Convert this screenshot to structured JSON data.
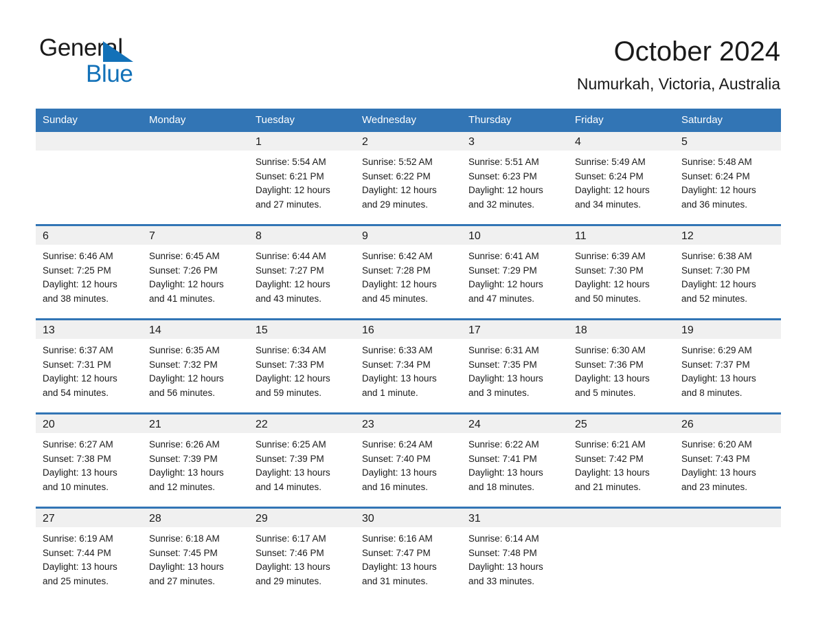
{
  "brand": {
    "name_line1": "General",
    "name_line2": "Blue",
    "accent_color": "#1271b8"
  },
  "header": {
    "month_title": "October 2024",
    "location": "Numurkah, Victoria, Australia"
  },
  "calendar": {
    "header_background": "#3275b5",
    "daynum_band_background": "#f0f0f0",
    "weekdays": [
      "Sunday",
      "Monday",
      "Tuesday",
      "Wednesday",
      "Thursday",
      "Friday",
      "Saturday"
    ],
    "weeks": [
      [
        {
          "day": "",
          "sunrise": "",
          "sunset": "",
          "daylight_line1": "",
          "daylight_line2": ""
        },
        {
          "day": "",
          "sunrise": "",
          "sunset": "",
          "daylight_line1": "",
          "daylight_line2": ""
        },
        {
          "day": "1",
          "sunrise": "Sunrise: 5:54 AM",
          "sunset": "Sunset: 6:21 PM",
          "daylight_line1": "Daylight: 12 hours",
          "daylight_line2": "and 27 minutes."
        },
        {
          "day": "2",
          "sunrise": "Sunrise: 5:52 AM",
          "sunset": "Sunset: 6:22 PM",
          "daylight_line1": "Daylight: 12 hours",
          "daylight_line2": "and 29 minutes."
        },
        {
          "day": "3",
          "sunrise": "Sunrise: 5:51 AM",
          "sunset": "Sunset: 6:23 PM",
          "daylight_line1": "Daylight: 12 hours",
          "daylight_line2": "and 32 minutes."
        },
        {
          "day": "4",
          "sunrise": "Sunrise: 5:49 AM",
          "sunset": "Sunset: 6:24 PM",
          "daylight_line1": "Daylight: 12 hours",
          "daylight_line2": "and 34 minutes."
        },
        {
          "day": "5",
          "sunrise": "Sunrise: 5:48 AM",
          "sunset": "Sunset: 6:24 PM",
          "daylight_line1": "Daylight: 12 hours",
          "daylight_line2": "and 36 minutes."
        }
      ],
      [
        {
          "day": "6",
          "sunrise": "Sunrise: 6:46 AM",
          "sunset": "Sunset: 7:25 PM",
          "daylight_line1": "Daylight: 12 hours",
          "daylight_line2": "and 38 minutes."
        },
        {
          "day": "7",
          "sunrise": "Sunrise: 6:45 AM",
          "sunset": "Sunset: 7:26 PM",
          "daylight_line1": "Daylight: 12 hours",
          "daylight_line2": "and 41 minutes."
        },
        {
          "day": "8",
          "sunrise": "Sunrise: 6:44 AM",
          "sunset": "Sunset: 7:27 PM",
          "daylight_line1": "Daylight: 12 hours",
          "daylight_line2": "and 43 minutes."
        },
        {
          "day": "9",
          "sunrise": "Sunrise: 6:42 AM",
          "sunset": "Sunset: 7:28 PM",
          "daylight_line1": "Daylight: 12 hours",
          "daylight_line2": "and 45 minutes."
        },
        {
          "day": "10",
          "sunrise": "Sunrise: 6:41 AM",
          "sunset": "Sunset: 7:29 PM",
          "daylight_line1": "Daylight: 12 hours",
          "daylight_line2": "and 47 minutes."
        },
        {
          "day": "11",
          "sunrise": "Sunrise: 6:39 AM",
          "sunset": "Sunset: 7:30 PM",
          "daylight_line1": "Daylight: 12 hours",
          "daylight_line2": "and 50 minutes."
        },
        {
          "day": "12",
          "sunrise": "Sunrise: 6:38 AM",
          "sunset": "Sunset: 7:30 PM",
          "daylight_line1": "Daylight: 12 hours",
          "daylight_line2": "and 52 minutes."
        }
      ],
      [
        {
          "day": "13",
          "sunrise": "Sunrise: 6:37 AM",
          "sunset": "Sunset: 7:31 PM",
          "daylight_line1": "Daylight: 12 hours",
          "daylight_line2": "and 54 minutes."
        },
        {
          "day": "14",
          "sunrise": "Sunrise: 6:35 AM",
          "sunset": "Sunset: 7:32 PM",
          "daylight_line1": "Daylight: 12 hours",
          "daylight_line2": "and 56 minutes."
        },
        {
          "day": "15",
          "sunrise": "Sunrise: 6:34 AM",
          "sunset": "Sunset: 7:33 PM",
          "daylight_line1": "Daylight: 12 hours",
          "daylight_line2": "and 59 minutes."
        },
        {
          "day": "16",
          "sunrise": "Sunrise: 6:33 AM",
          "sunset": "Sunset: 7:34 PM",
          "daylight_line1": "Daylight: 13 hours",
          "daylight_line2": "and 1 minute."
        },
        {
          "day": "17",
          "sunrise": "Sunrise: 6:31 AM",
          "sunset": "Sunset: 7:35 PM",
          "daylight_line1": "Daylight: 13 hours",
          "daylight_line2": "and 3 minutes."
        },
        {
          "day": "18",
          "sunrise": "Sunrise: 6:30 AM",
          "sunset": "Sunset: 7:36 PM",
          "daylight_line1": "Daylight: 13 hours",
          "daylight_line2": "and 5 minutes."
        },
        {
          "day": "19",
          "sunrise": "Sunrise: 6:29 AM",
          "sunset": "Sunset: 7:37 PM",
          "daylight_line1": "Daylight: 13 hours",
          "daylight_line2": "and 8 minutes."
        }
      ],
      [
        {
          "day": "20",
          "sunrise": "Sunrise: 6:27 AM",
          "sunset": "Sunset: 7:38 PM",
          "daylight_line1": "Daylight: 13 hours",
          "daylight_line2": "and 10 minutes."
        },
        {
          "day": "21",
          "sunrise": "Sunrise: 6:26 AM",
          "sunset": "Sunset: 7:39 PM",
          "daylight_line1": "Daylight: 13 hours",
          "daylight_line2": "and 12 minutes."
        },
        {
          "day": "22",
          "sunrise": "Sunrise: 6:25 AM",
          "sunset": "Sunset: 7:39 PM",
          "daylight_line1": "Daylight: 13 hours",
          "daylight_line2": "and 14 minutes."
        },
        {
          "day": "23",
          "sunrise": "Sunrise: 6:24 AM",
          "sunset": "Sunset: 7:40 PM",
          "daylight_line1": "Daylight: 13 hours",
          "daylight_line2": "and 16 minutes."
        },
        {
          "day": "24",
          "sunrise": "Sunrise: 6:22 AM",
          "sunset": "Sunset: 7:41 PM",
          "daylight_line1": "Daylight: 13 hours",
          "daylight_line2": "and 18 minutes."
        },
        {
          "day": "25",
          "sunrise": "Sunrise: 6:21 AM",
          "sunset": "Sunset: 7:42 PM",
          "daylight_line1": "Daylight: 13 hours",
          "daylight_line2": "and 21 minutes."
        },
        {
          "day": "26",
          "sunrise": "Sunrise: 6:20 AM",
          "sunset": "Sunset: 7:43 PM",
          "daylight_line1": "Daylight: 13 hours",
          "daylight_line2": "and 23 minutes."
        }
      ],
      [
        {
          "day": "27",
          "sunrise": "Sunrise: 6:19 AM",
          "sunset": "Sunset: 7:44 PM",
          "daylight_line1": "Daylight: 13 hours",
          "daylight_line2": "and 25 minutes."
        },
        {
          "day": "28",
          "sunrise": "Sunrise: 6:18 AM",
          "sunset": "Sunset: 7:45 PM",
          "daylight_line1": "Daylight: 13 hours",
          "daylight_line2": "and 27 minutes."
        },
        {
          "day": "29",
          "sunrise": "Sunrise: 6:17 AM",
          "sunset": "Sunset: 7:46 PM",
          "daylight_line1": "Daylight: 13 hours",
          "daylight_line2": "and 29 minutes."
        },
        {
          "day": "30",
          "sunrise": "Sunrise: 6:16 AM",
          "sunset": "Sunset: 7:47 PM",
          "daylight_line1": "Daylight: 13 hours",
          "daylight_line2": "and 31 minutes."
        },
        {
          "day": "31",
          "sunrise": "Sunrise: 6:14 AM",
          "sunset": "Sunset: 7:48 PM",
          "daylight_line1": "Daylight: 13 hours",
          "daylight_line2": "and 33 minutes."
        },
        {
          "day": "",
          "sunrise": "",
          "sunset": "",
          "daylight_line1": "",
          "daylight_line2": ""
        },
        {
          "day": "",
          "sunrise": "",
          "sunset": "",
          "daylight_line1": "",
          "daylight_line2": ""
        }
      ]
    ]
  }
}
